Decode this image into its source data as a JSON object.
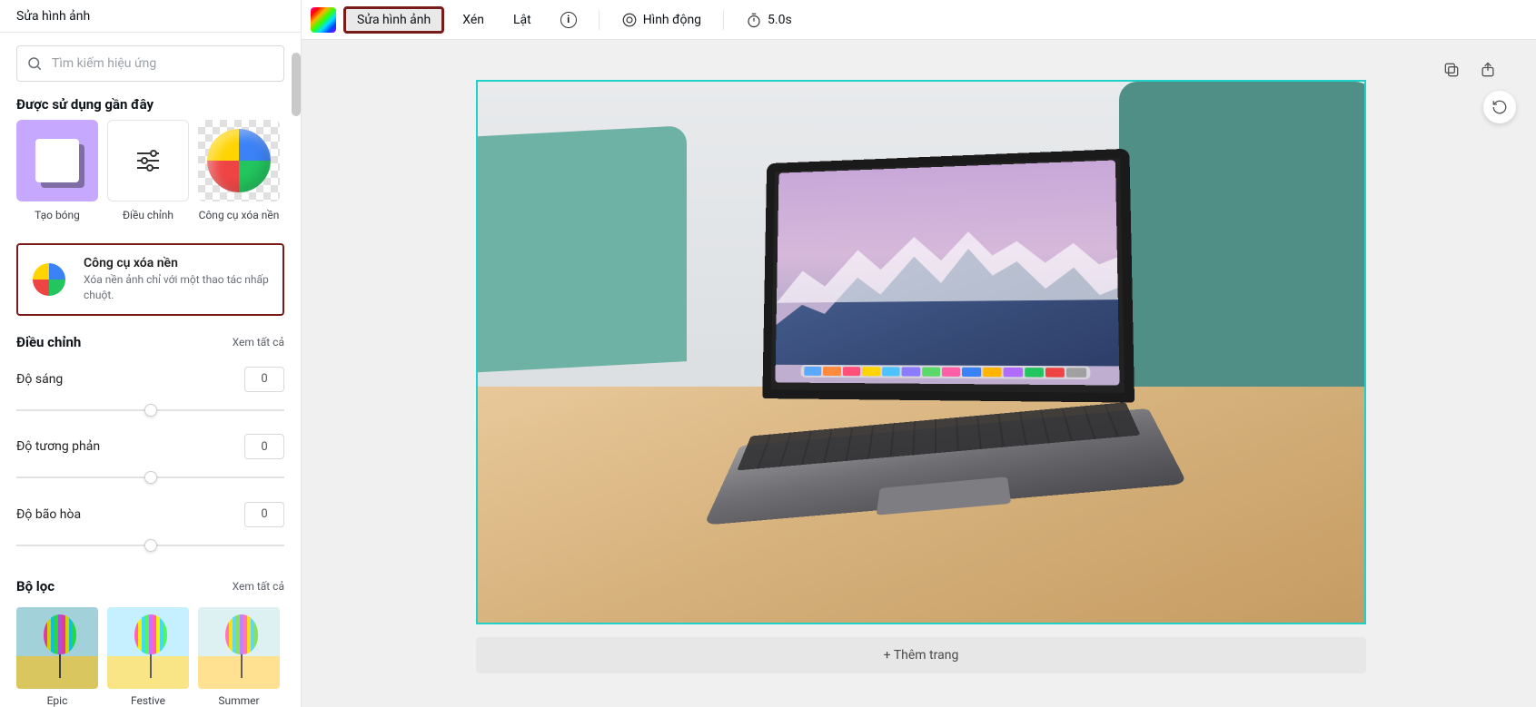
{
  "sidebar": {
    "panelTitle": "Sửa hình ảnh",
    "search": {
      "placeholder": "Tìm kiếm hiệu ứng"
    },
    "recent": {
      "heading": "Được sử dụng gần đây",
      "items": [
        {
          "label": "Tạo bóng"
        },
        {
          "label": "Điều chỉnh"
        },
        {
          "label": "Công cụ xóa nền"
        }
      ]
    },
    "bgRemover": {
      "title": "Công cụ xóa nền",
      "desc": "Xóa nền ảnh chỉ với một thao tác nhấp chuột."
    },
    "adjust": {
      "heading": "Điều chỉnh",
      "seeAll": "Xem tất cả",
      "brightness": {
        "label": "Độ sáng",
        "value": "0"
      },
      "contrast": {
        "label": "Độ tương phản",
        "value": "0"
      },
      "saturation": {
        "label": "Độ bão hòa",
        "value": "0"
      }
    },
    "filters": {
      "heading": "Bộ lọc",
      "seeAll": "Xem tất cả",
      "items": [
        {
          "label": "Epic"
        },
        {
          "label": "Festive"
        },
        {
          "label": "Summer"
        }
      ]
    }
  },
  "toolbar": {
    "editImage": "Sửa hình ảnh",
    "crop": "Xén",
    "flip": "Lật",
    "animate": "Hình động",
    "duration": "5.0s"
  },
  "canvas": {
    "addPage": "+ Thêm trang"
  }
}
